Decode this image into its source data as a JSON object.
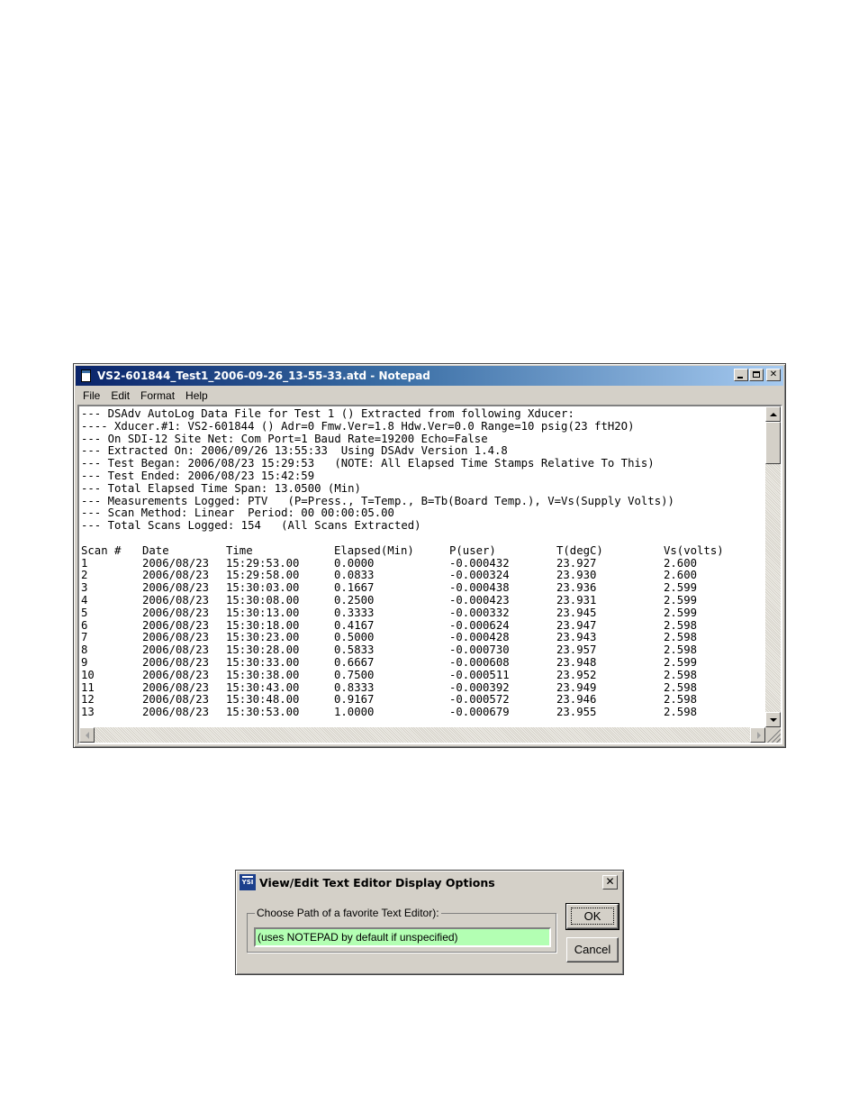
{
  "notepad": {
    "title": "VS2-601844_Test1_2006-09-26_13-55-33.atd - Notepad",
    "menu": [
      "File",
      "Edit",
      "Format",
      "Help"
    ],
    "header_lines": [
      "--- DSAdv AutoLog Data File for Test 1 () Extracted from following Xducer:",
      "---- Xducer.#1: VS2-601844 () Adr=0 Fmw.Ver=1.8 Hdw.Ver=0.0 Range=10 psig(23 ftH2O)",
      "--- On SDI-12 Site Net: Com Port=1 Baud Rate=19200 Echo=False",
      "--- Extracted On: 2006/09/26 13:55:33  Using DSAdv Version 1.4.8",
      "--- Test Began: 2006/08/23 15:29:53   (NOTE: All Elapsed Time Stamps Relative To This)",
      "--- Test Ended: 2006/08/23 15:42:59",
      "--- Total Elapsed Time Span: 13.0500 (Min)",
      "--- Measurements Logged: PTV   (P=Press., T=Temp., B=Tb(Board Temp.), V=Vs(Supply Volts))",
      "--- Scan Method: Linear  Period: 00 00:00:05.00",
      "--- Total Scans Logged: 154   (All Scans Extracted)"
    ],
    "columns": [
      "Scan #",
      "Date",
      "Time",
      "Elapsed(Min)",
      "P(user)",
      "T(degC)",
      "Vs(volts)"
    ],
    "rows": [
      [
        "1",
        "2006/08/23",
        "15:29:53.00",
        "0.0000",
        "-0.000432",
        "23.927",
        "2.600"
      ],
      [
        "2",
        "2006/08/23",
        "15:29:58.00",
        "0.0833",
        "-0.000324",
        "23.930",
        "2.600"
      ],
      [
        "3",
        "2006/08/23",
        "15:30:03.00",
        "0.1667",
        "-0.000438",
        "23.936",
        "2.599"
      ],
      [
        "4",
        "2006/08/23",
        "15:30:08.00",
        "0.2500",
        "-0.000423",
        "23.931",
        "2.599"
      ],
      [
        "5",
        "2006/08/23",
        "15:30:13.00",
        "0.3333",
        "-0.000332",
        "23.945",
        "2.599"
      ],
      [
        "6",
        "2006/08/23",
        "15:30:18.00",
        "0.4167",
        "-0.000624",
        "23.947",
        "2.598"
      ],
      [
        "7",
        "2006/08/23",
        "15:30:23.00",
        "0.5000",
        "-0.000428",
        "23.943",
        "2.598"
      ],
      [
        "8",
        "2006/08/23",
        "15:30:28.00",
        "0.5833",
        "-0.000730",
        "23.957",
        "2.598"
      ],
      [
        "9",
        "2006/08/23",
        "15:30:33.00",
        "0.6667",
        "-0.000608",
        "23.948",
        "2.599"
      ],
      [
        "10",
        "2006/08/23",
        "15:30:38.00",
        "0.7500",
        "-0.000511",
        "23.952",
        "2.598"
      ],
      [
        "11",
        "2006/08/23",
        "15:30:43.00",
        "0.8333",
        "-0.000392",
        "23.949",
        "2.598"
      ],
      [
        "12",
        "2006/08/23",
        "15:30:48.00",
        "0.9167",
        "-0.000572",
        "23.946",
        "2.598"
      ],
      [
        "13",
        "2006/08/23",
        "15:30:53.00",
        "1.0000",
        "-0.000679",
        "23.955",
        "2.598"
      ]
    ]
  },
  "dialog": {
    "title": "View/Edit Text Editor Display Options",
    "icon_text": "YSI",
    "group_label": "Choose Path of a favorite Text Editor):",
    "path_value": "(uses NOTEPAD by default if unspecified)",
    "ok_label": "OK",
    "cancel_label": "Cancel",
    "input_color": "#b3ffb3"
  }
}
